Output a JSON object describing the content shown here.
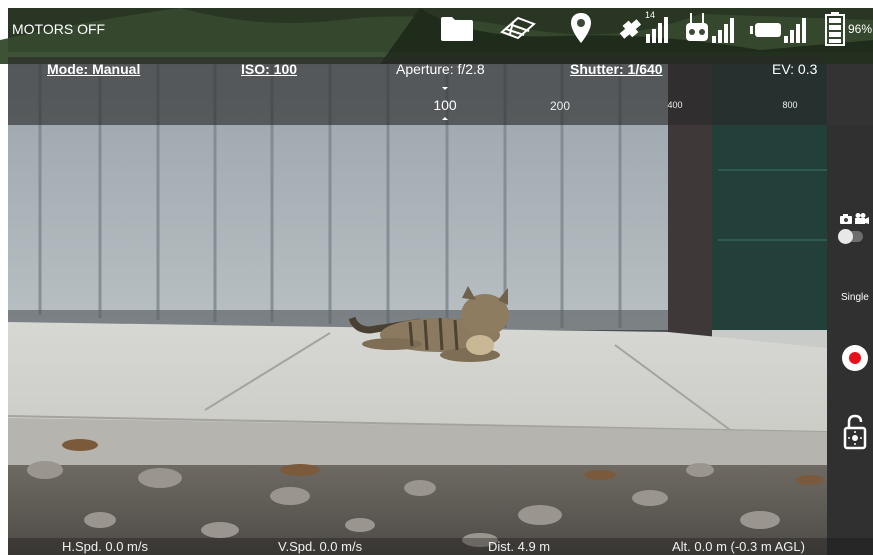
{
  "status": {
    "motors": "MOTORS OFF",
    "satellite_count": "14",
    "battery_percent": "96%",
    "icons": [
      "folder-icon",
      "satellite-map-icon",
      "location-pin-icon",
      "satellite-signal-icon",
      "remote-controller-signal-icon",
      "video-link-signal-icon",
      "battery-icon"
    ]
  },
  "exposure": {
    "mode": "Mode: Manual",
    "iso": "ISO: 100",
    "aperture": "Aperture: f/2.8",
    "shutter": "Shutter: 1/640",
    "ev": "EV: 0.3"
  },
  "iso_scale": {
    "ticks": [
      "100",
      "200",
      "400",
      "800"
    ],
    "selected": "100"
  },
  "right_panel": {
    "capture_mode": "Single",
    "mode_toggle": "photo",
    "icons": [
      "camera-icon",
      "video-camera-icon",
      "record-button-icon",
      "exposure-lock-icon"
    ]
  },
  "telemetry": {
    "h_speed": "H.Spd. 0.0 m/s",
    "v_speed": "V.Spd. 0.0 m/s",
    "distance": "Dist. 4.9 m",
    "altitude": "Alt. 0.0 m (-0.3 m AGL)"
  }
}
